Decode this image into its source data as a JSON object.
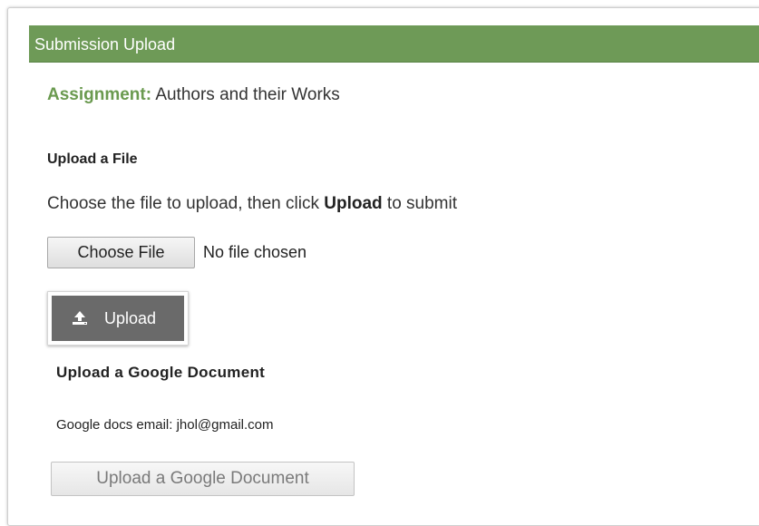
{
  "header": {
    "title": "Submission Upload",
    "color": "#6e9a57"
  },
  "assignment": {
    "label": "Assignment:",
    "name": "Authors and their Works"
  },
  "upload_file": {
    "heading": "Upload a File",
    "instructions_prefix": "Choose the file to upload, then click ",
    "instructions_bold": "Upload",
    "instructions_suffix": " to submit",
    "choose_button": "Choose File",
    "no_file_text": "No file chosen",
    "upload_button": "Upload",
    "upload_icon": "upload-icon"
  },
  "google": {
    "heading": "Upload a Google Document",
    "email_text": "Google docs email: jhol@gmail.com",
    "button": "Upload a Google Document",
    "button_disabled": true
  }
}
